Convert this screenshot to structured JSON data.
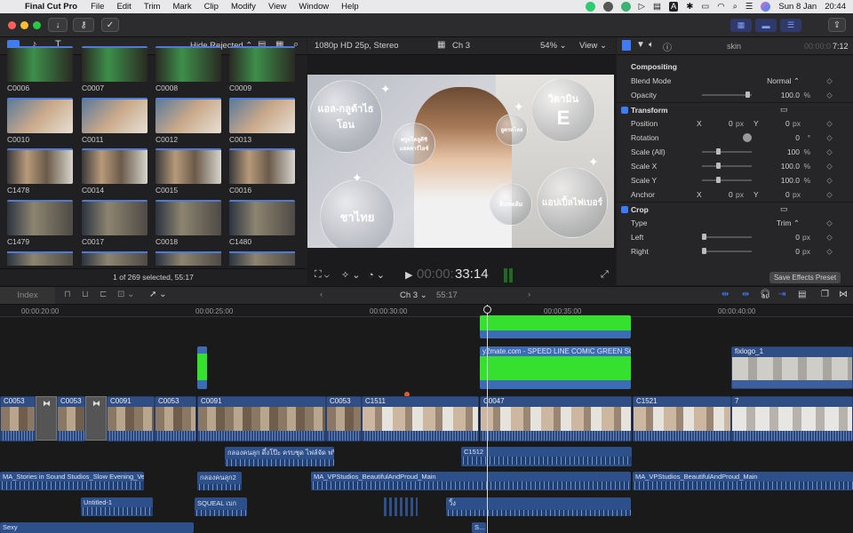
{
  "menubar": {
    "app": "Final Cut Pro",
    "items": [
      "File",
      "Edit",
      "Trim",
      "Mark",
      "Clip",
      "Modify",
      "View",
      "Window",
      "Help"
    ],
    "input_badge": "A",
    "date": "Sun 8 Jan",
    "time": "20:44"
  },
  "browser": {
    "filter_label": "Hide Rejected",
    "clips": [
      {
        "label": "C0006"
      },
      {
        "label": "C0007"
      },
      {
        "label": "C0008"
      },
      {
        "label": "C0009"
      },
      {
        "label": "C0010"
      },
      {
        "label": "C0011"
      },
      {
        "label": "C0012"
      },
      {
        "label": "C0013"
      },
      {
        "label": "C1478"
      },
      {
        "label": "C0014"
      },
      {
        "label": "C0015"
      },
      {
        "label": "C0016"
      },
      {
        "label": "C1479"
      },
      {
        "label": "C0017"
      },
      {
        "label": "C0018"
      },
      {
        "label": "C1480"
      }
    ],
    "status": "1 of 269 selected, 55:17"
  },
  "viewer": {
    "format": "1080p HD 25p, Stereo",
    "project": "Ch 3",
    "zoom": "54%",
    "view_label": "View",
    "timecode_dim": "00:00:",
    "timecode": "33:14",
    "overlay": {
      "b1": "แอล-กลูต้าไธโอน",
      "b2": "วิตามิน",
      "b2big": "E",
      "b3": "ชาไทย",
      "b4": "แอปเปิ้ลไฟเบอร์",
      "s1": "พรูคโคลูดีซิ\nแลคคาร์ไอซ์",
      "s2": "อูครดไลล",
      "s3": "อินทผลัม"
    }
  },
  "inspector": {
    "clip_name": "skin",
    "timecode_dim": "00:00:0",
    "timecode": "7:12",
    "rows": [
      {
        "name": "Compositing",
        "type": "section"
      },
      {
        "name": "Blend Mode",
        "value": "Normal ⌃"
      },
      {
        "name": "Opacity",
        "value": "100.0",
        "unit": "%",
        "level": 0.95
      },
      {
        "name": "Transform",
        "type": "section_check"
      },
      {
        "name": "Position",
        "x": "0",
        "xu": "px",
        "y": "0",
        "yu": "px"
      },
      {
        "name": "Rotation",
        "value": "0",
        "unit": "°"
      },
      {
        "name": "Scale (All)",
        "value": "100",
        "unit": "%",
        "level": 0.3
      },
      {
        "name": "Scale X",
        "value": "100.0",
        "unit": "%",
        "level": 0.3
      },
      {
        "name": "Scale Y",
        "value": "100.0",
        "unit": "%",
        "level": 0.3
      },
      {
        "name": "Anchor",
        "x": "0",
        "xu": "px",
        "y": "0",
        "yu": "px"
      },
      {
        "name": "Crop",
        "type": "section_check"
      },
      {
        "name": "Type",
        "value": "Trim ⌃"
      },
      {
        "name": "Left",
        "value": "0",
        "unit": "px",
        "level": 0.0
      },
      {
        "name": "Right",
        "value": "0",
        "unit": "px",
        "level": 0.0
      }
    ],
    "x_label": "X",
    "y_label": "Y",
    "save_preset": "Save Effects Preset"
  },
  "timeline": {
    "index_label": "Index",
    "project": "Ch 3",
    "duration": "55:17",
    "ruler": [
      "00:00:20:00",
      "00:00:25:00",
      "00:00:30:00",
      "00:00:35:00",
      "00:00:40:00"
    ],
    "titles": {
      "green_top": "",
      "speed_line": "y2mate.com - SPEED LINE COMIC GREEN SCREEN...",
      "fixlogo": "fixlogo_1"
    },
    "primary": [
      "C0053",
      "C0053",
      "C0091",
      "C0053",
      "C0091",
      "C0053",
      "C1511",
      "C0047",
      "C1521",
      "7"
    ],
    "connected": {
      "thai_caption": "กลองคนลุก ดึ๋งโป๊ะ ครบชุด ไฟล์จัด ฟรี]",
      "c1512": "C1512"
    },
    "audio": {
      "stories": "MA_Stories in Sound Studios_Slow Evening_Ver...",
      "klong2": "กลองคนลุก2",
      "vp1": "MA_VPStudios_BeautifulAndProud_Main",
      "vp2": "MA_VPStudios_BeautifulAndProud_Main",
      "untitled": "Untitled-1",
      "squeal": "SQUEAL เบก",
      "wing": "วิ้ง",
      "sexy": "Sexy",
      "s": "S..."
    }
  },
  "colors": {
    "accent": "#3f7bf3",
    "green_screen": "#35e02e",
    "clip_blue": "#3d5f9c"
  }
}
